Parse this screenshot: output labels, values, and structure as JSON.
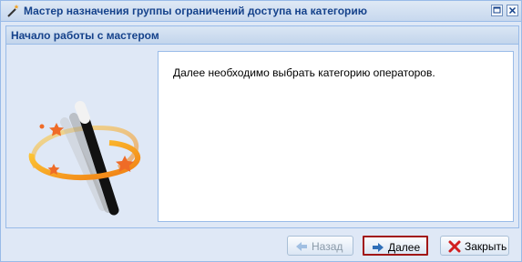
{
  "window": {
    "title": "Мастер назначения группы ограничений доступа на категорию"
  },
  "panel": {
    "title": "Начало работы с мастером"
  },
  "content": {
    "text": "Далее необходимо выбрать категорию операторов."
  },
  "buttons": {
    "back": "Назад",
    "next": "Далее",
    "close": "Закрыть"
  },
  "icons": {
    "title": "magic-wand-icon",
    "maximize": "maximize-icon",
    "close": "close-icon",
    "illustration": "magic-wand-illustration",
    "back": "arrow-left-icon",
    "next": "arrow-right-icon",
    "close_button": "red-x-icon"
  },
  "colors": {
    "title_text": "#15428b",
    "border": "#99bbe8",
    "highlight": "#a11616",
    "accent_orange": "#f59a1d"
  }
}
